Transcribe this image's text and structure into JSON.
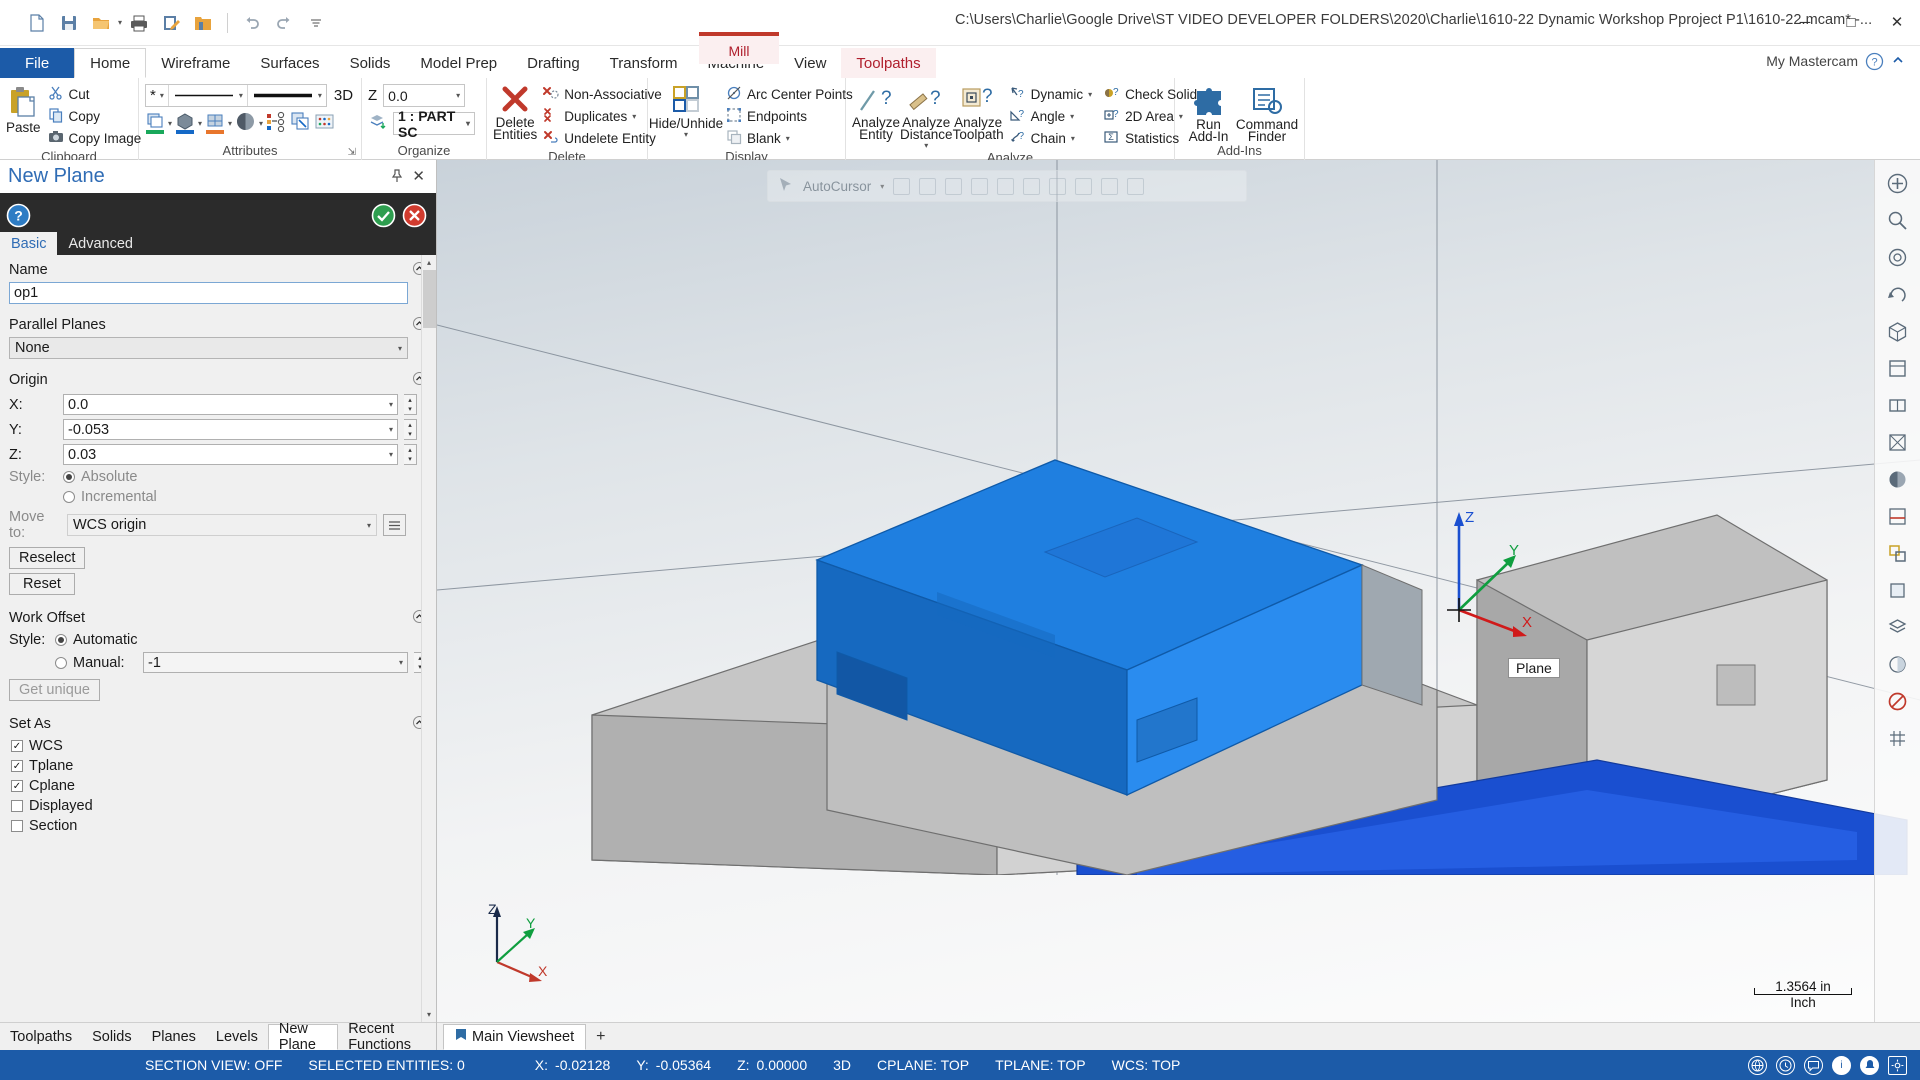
{
  "titlebar": {
    "document_path": "C:\\Users\\Charlie\\Google Drive\\ST VIDEO DEVELOPER FOLDERS\\2020\\Charlie\\1610-22 Dynamic Workshop Pproject P1\\1610-22.mcam* -...",
    "quick_access": [
      {
        "name": "new-icon",
        "label": "New"
      },
      {
        "name": "save-icon",
        "label": "Save"
      },
      {
        "name": "open-icon",
        "label": "Open"
      },
      {
        "name": "print-icon",
        "label": "Print"
      },
      {
        "name": "edit-note-icon",
        "label": "Edit"
      },
      {
        "name": "folder-icon",
        "label": "Folder"
      },
      {
        "name": "undo-icon",
        "label": "Undo"
      },
      {
        "name": "redo-icon",
        "label": "Redo"
      },
      {
        "name": "customize-icon",
        "label": "Customize Quick Access Toolbar"
      }
    ],
    "window_controls": {
      "minimize": "─",
      "maximize": "□",
      "close": "✕"
    }
  },
  "ribbon": {
    "tabs": [
      {
        "label": "File",
        "type": "file"
      },
      {
        "label": "Home",
        "type": "active"
      },
      {
        "label": "Wireframe",
        "type": "normal"
      },
      {
        "label": "Surfaces",
        "type": "normal"
      },
      {
        "label": "Solids",
        "type": "normal"
      },
      {
        "label": "Model Prep",
        "type": "normal"
      },
      {
        "label": "Drafting",
        "type": "normal"
      },
      {
        "label": "Transform",
        "type": "normal"
      },
      {
        "label": "Machine",
        "type": "normal"
      },
      {
        "label": "View",
        "type": "normal"
      },
      {
        "label": "Toolpaths",
        "type": "context"
      }
    ],
    "context_group": {
      "label": "Mill",
      "color": "#c0392b"
    },
    "account_label": "My Mastercam",
    "groups": {
      "clipboard": {
        "label": "Clipboard",
        "paste": "Paste",
        "items": [
          {
            "label": "Cut",
            "icon": "scissors-icon"
          },
          {
            "label": "Copy",
            "icon": "copy-icon"
          },
          {
            "label": "Copy Image",
            "icon": "camera-icon"
          }
        ]
      },
      "attributes": {
        "label": "Attributes",
        "point_style": "*",
        "line_style": "solid-line",
        "line_width": "thick-line",
        "depth_label": "3D",
        "swatches": [
          "#19a85b",
          "#1569c7",
          "#e8762c"
        ]
      },
      "organize": {
        "label": "Organize",
        "z_label": "Z",
        "z_value": "0.0",
        "level_value": "1 : PART SC"
      },
      "delete": {
        "label": "Delete",
        "main": "Delete Entities",
        "items": [
          {
            "label": "Non-Associative"
          },
          {
            "label": "Duplicates",
            "has_caret": true
          },
          {
            "label": "Undelete Entity"
          }
        ]
      },
      "display": {
        "label": "Display",
        "main": "Hide/Unhide",
        "items": [
          {
            "label": "Arc Center Points"
          },
          {
            "label": "Endpoints"
          },
          {
            "label": "Blank",
            "has_caret": true
          }
        ]
      },
      "analyze": {
        "label": "Analyze",
        "big": [
          {
            "label": "Analyze Entity"
          },
          {
            "label": "Analyze Distance",
            "has_caret": true
          },
          {
            "label": "Analyze Toolpath"
          }
        ],
        "col1": [
          {
            "label": "Dynamic",
            "has_caret": true
          },
          {
            "label": "Angle",
            "has_caret": true
          },
          {
            "label": "Chain",
            "has_caret": true
          }
        ],
        "col2": [
          {
            "label": "Check Solid",
            "has_caret": true
          },
          {
            "label": "2D Area",
            "has_caret": true
          },
          {
            "label": "Statistics"
          }
        ]
      },
      "addins": {
        "label": "Add-Ins",
        "items": [
          {
            "label": "Run Add-In"
          },
          {
            "label": "Command Finder"
          }
        ]
      }
    }
  },
  "panel": {
    "title": "New Plane",
    "tabs": [
      {
        "label": "Basic",
        "active": true
      },
      {
        "label": "Advanced",
        "active": false
      }
    ],
    "name_section": {
      "header": "Name",
      "value": "op1"
    },
    "parallel_planes": {
      "header": "Parallel Planes",
      "value": "None"
    },
    "origin": {
      "header": "Origin",
      "fields": [
        {
          "label": "X:",
          "value": "0.0"
        },
        {
          "label": "Y:",
          "value": "-0.053"
        },
        {
          "label": "Z:",
          "value": "0.03"
        }
      ],
      "style_label": "Style:",
      "style_options": [
        {
          "label": "Absolute",
          "selected": true
        },
        {
          "label": "Incremental",
          "selected": false
        }
      ],
      "move_to_label": "Move to:",
      "move_to_value": "WCS origin",
      "reselect_button": "Reselect",
      "reset_button": "Reset"
    },
    "work_offset": {
      "header": "Work Offset",
      "style_label": "Style:",
      "options": [
        {
          "label": "Automatic",
          "selected": true
        },
        {
          "label": "Manual:",
          "selected": false
        }
      ],
      "manual_value": "-1",
      "get_unique_button": "Get unique"
    },
    "set_as": {
      "header": "Set As",
      "items": [
        {
          "label": "WCS",
          "checked": true
        },
        {
          "label": "Tplane",
          "checked": true
        },
        {
          "label": "Cplane",
          "checked": true
        },
        {
          "label": "Displayed",
          "checked": false
        },
        {
          "label": "Section",
          "checked": false
        }
      ]
    },
    "bottom_tabs": [
      {
        "label": "Toolpaths",
        "active": false
      },
      {
        "label": "Solids",
        "active": false
      },
      {
        "label": "Planes",
        "active": false
      },
      {
        "label": "Levels",
        "active": false
      },
      {
        "label": "New Plane",
        "active": true
      },
      {
        "label": "Recent Functions",
        "active": false
      }
    ]
  },
  "viewport": {
    "autocursor_label": "AutoCursor",
    "plane_tooltip": "Plane",
    "axis_labels": {
      "x": "X",
      "y": "Y",
      "z": "Z"
    },
    "scale_value": "1.3564 in",
    "scale_units": "Inch",
    "viewsheet_tab": "Main Viewsheet",
    "viewsheet_add": "+"
  },
  "statusbar": {
    "section_view": "SECTION VIEW: OFF",
    "selected_entities": "SELECTED ENTITIES: 0",
    "x_label": "X:",
    "x_value": "-0.02128",
    "y_label": "Y:",
    "y_value": "-0.05364",
    "z_label": "Z:",
    "z_value": "0.00000",
    "mode": "3D",
    "cplane": "CPLANE: TOP",
    "tplane": "TPLANE: TOP",
    "wcs": "WCS: TOP"
  }
}
